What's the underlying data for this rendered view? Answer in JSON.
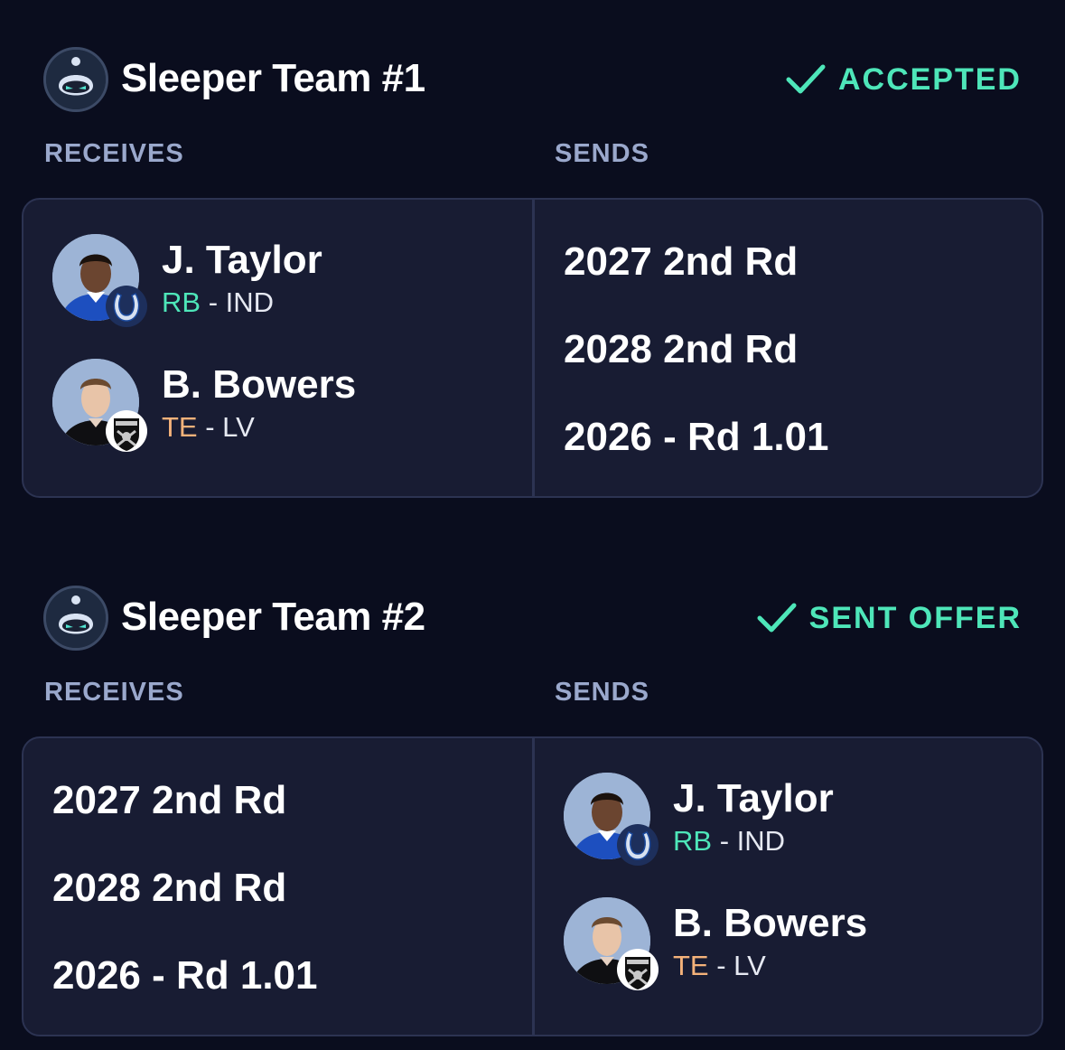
{
  "trades": [
    {
      "team_name": "Sleeper Team #1",
      "status": "ACCEPTED",
      "receives_label": "RECEIVES",
      "sends_label": "SENDS",
      "receives_players": [
        {
          "name": "J. Taylor",
          "position": "RB",
          "team": "- IND"
        },
        {
          "name": "B. Bowers",
          "position": "TE",
          "team": "- LV"
        }
      ],
      "sends_picks": [
        "2027 2nd Rd",
        "2028 2nd Rd",
        "2026 - Rd 1.01"
      ]
    },
    {
      "team_name": "Sleeper Team #2",
      "status": "SENT OFFER",
      "receives_label": "RECEIVES",
      "sends_label": "SENDS",
      "receives_picks": [
        "2027 2nd Rd",
        "2028 2nd Rd",
        "2026 - Rd 1.01"
      ],
      "sends_players": [
        {
          "name": "J. Taylor",
          "position": "RB",
          "team": "- IND"
        },
        {
          "name": "B. Bowers",
          "position": "TE",
          "team": "- LV"
        }
      ]
    }
  ],
  "colors": {
    "background": "#0a0d1e",
    "panel": "#181c33",
    "accent_green": "#4ee6b9",
    "label_gray": "#9aa8cc",
    "rb_color": "#4ee6b9",
    "te_color": "#f4b27a"
  },
  "icons": [
    "sleeper-team-avatar-icon",
    "checkmark-icon",
    "colts-logo-icon",
    "raiders-logo-icon"
  ]
}
